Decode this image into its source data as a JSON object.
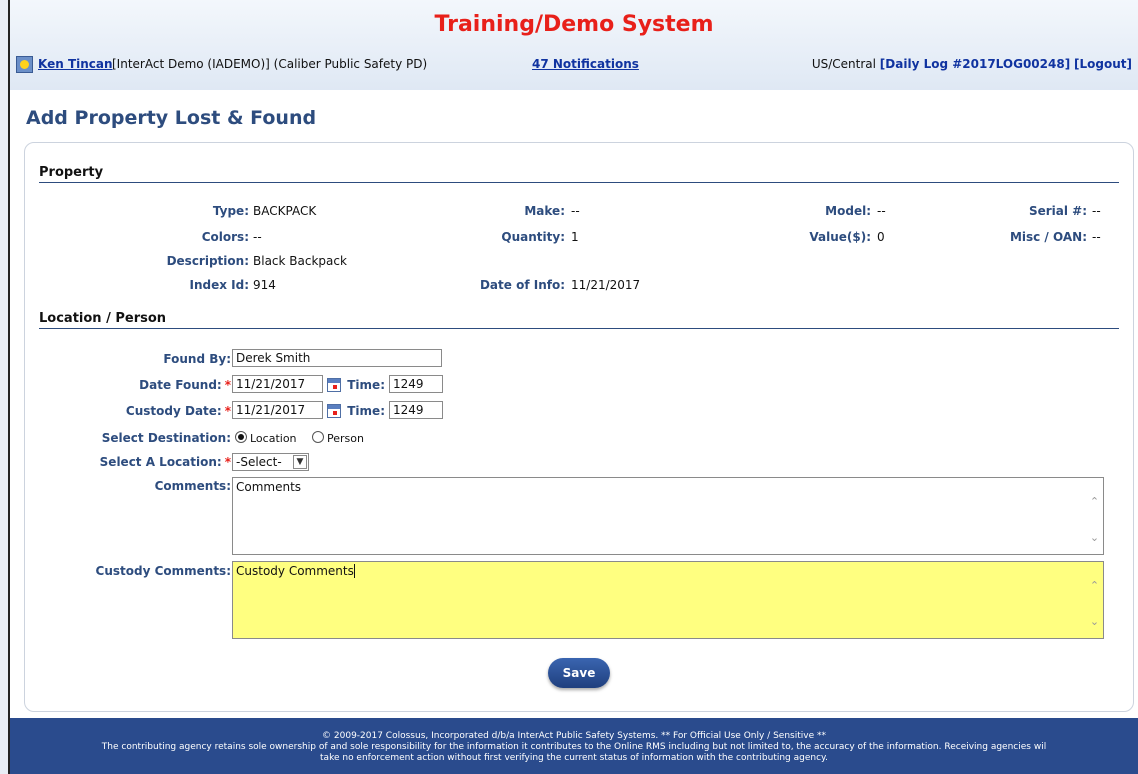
{
  "header": {
    "system_title": "Training/Demo System",
    "user_name": "Ken Tincan",
    "user_info": "[InterAct Demo (IADEMO)] (Caliber Public Safety PD)",
    "notifications": "47 Notifications",
    "timezone": "US/Central",
    "daily_log": "[Daily Log #2017LOG00248]",
    "logout": "[Logout]"
  },
  "page": {
    "title": "Add Property Lost & Found"
  },
  "property": {
    "section_title": "Property",
    "type_label": "Type:",
    "type_value": "BACKPACK",
    "make_label": "Make:",
    "make_value": "--",
    "model_label": "Model:",
    "model_value": "--",
    "serial_label": "Serial #:",
    "serial_value": "--",
    "colors_label": "Colors:",
    "colors_value": "--",
    "quantity_label": "Quantity:",
    "quantity_value": "1",
    "value_label": "Value($):",
    "value_value": "0",
    "misc_label": "Misc / OAN:",
    "misc_value": "--",
    "description_label": "Description:",
    "description_value": "Black Backpack",
    "index_label": "Index Id:",
    "index_value": "914",
    "date_info_label": "Date of Info:",
    "date_info_value": "11/21/2017"
  },
  "location": {
    "section_title": "Location / Person",
    "found_by_label": "Found By:",
    "found_by_value": "Derek Smith",
    "date_found_label": "Date Found:",
    "date_found_value": "11/21/2017",
    "time_label": "Time:",
    "date_found_time": "1249",
    "custody_date_label": "Custody Date:",
    "custody_date_value": "11/21/2017",
    "custody_time": "1249",
    "required_mark": "*",
    "destination_label": "Select Destination:",
    "destination_options": [
      "Location",
      "Person"
    ],
    "destination_selected": "Location",
    "select_location_label": "Select A Location:",
    "select_location_value": "-Select-",
    "comments_label": "Comments:",
    "comments_value": "Comments",
    "custody_comments_label": "Custody Comments:",
    "custody_comments_value": "Custody Comments",
    "custody_comments_bg": "#ffff80"
  },
  "actions": {
    "save_label": "Save"
  },
  "footer": {
    "line1": "© 2009-2017 Colossus, Incorporated d/b/a InterAct Public Safety Systems. ** For Official Use Only / Sensitive **",
    "line2": "The contributing agency retains sole ownership of and sole responsibility for the information it contributes to the Online RMS including but not limited to, the accuracy of the information. Receiving agencies wil",
    "line3": "take no enforcement action without first verifying the current status of information with the contributing agency."
  },
  "colors": {
    "accent": "#2d4c7e",
    "title_red": "#e8201a",
    "footer_bg": "#2a4b8d"
  }
}
